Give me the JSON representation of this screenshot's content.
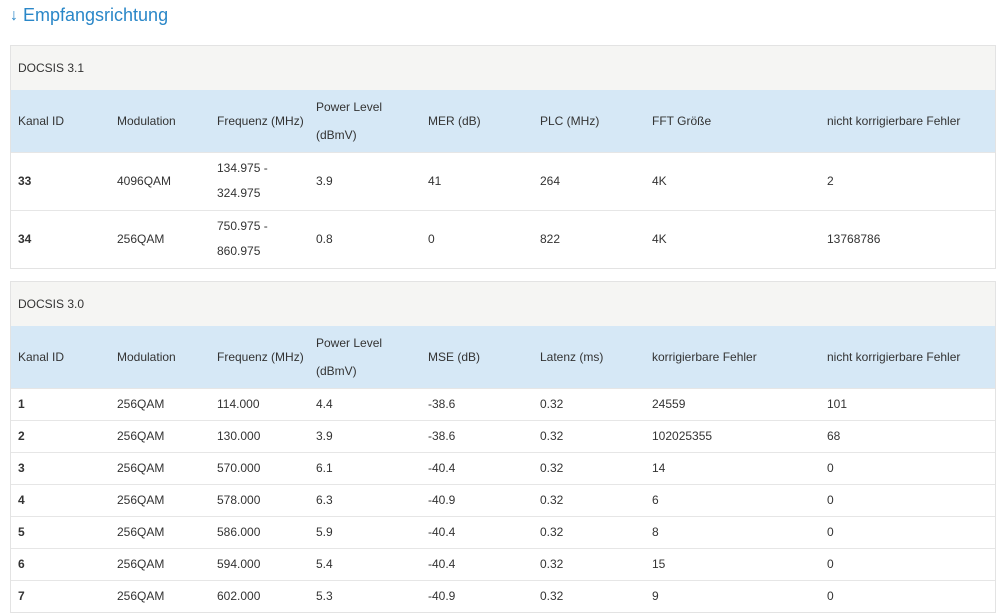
{
  "heading": {
    "icon": "arrow-down-icon",
    "arrow": "↓",
    "title": "Empfangsrichtung"
  },
  "docsis31": {
    "label": "DOCSIS 3.1",
    "columns": [
      "Kanal ID",
      "Modulation",
      "Frequenz (MHz)",
      "Power Level (dBmV)",
      "MER (dB)",
      "PLC (MHz)",
      "FFT Größe",
      "nicht korrigierbare Fehler"
    ],
    "rows": [
      [
        "33",
        "4096QAM",
        "134.975 - 324.975",
        "3.9",
        "41",
        "264",
        "4K",
        "2"
      ],
      [
        "34",
        "256QAM",
        "750.975 - 860.975",
        "0.8",
        "0",
        "822",
        "4K",
        "13768786"
      ]
    ]
  },
  "docsis30": {
    "label": "DOCSIS 3.0",
    "columns": [
      "Kanal ID",
      "Modulation",
      "Frequenz (MHz)",
      "Power Level (dBmV)",
      "MSE (dB)",
      "Latenz (ms)",
      "korrigierbare Fehler",
      "nicht korrigierbare Fehler"
    ],
    "rows": [
      [
        "1",
        "256QAM",
        "114.000",
        "4.4",
        "-38.6",
        "0.32",
        "24559",
        "101"
      ],
      [
        "2",
        "256QAM",
        "130.000",
        "3.9",
        "-38.6",
        "0.32",
        "102025355",
        "68"
      ],
      [
        "3",
        "256QAM",
        "570.000",
        "6.1",
        "-40.4",
        "0.32",
        "14",
        "0"
      ],
      [
        "4",
        "256QAM",
        "578.000",
        "6.3",
        "-40.9",
        "0.32",
        "6",
        "0"
      ],
      [
        "5",
        "256QAM",
        "586.000",
        "5.9",
        "-40.4",
        "0.32",
        "8",
        "0"
      ],
      [
        "6",
        "256QAM",
        "594.000",
        "5.4",
        "-40.4",
        "0.32",
        "15",
        "0"
      ],
      [
        "7",
        "256QAM",
        "602.000",
        "5.3",
        "-40.9",
        "0.32",
        "9",
        "0"
      ]
    ]
  }
}
